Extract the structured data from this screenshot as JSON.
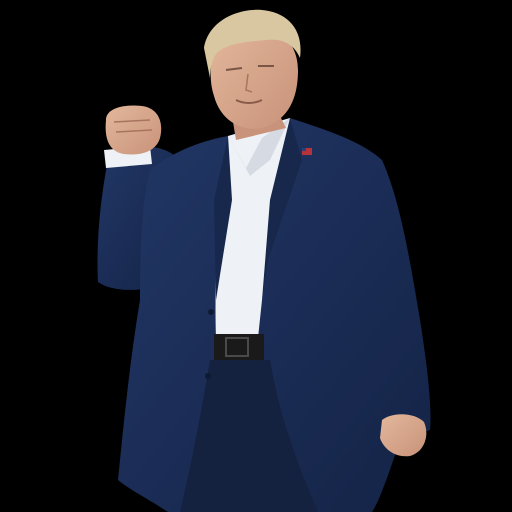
{
  "scene": {
    "background_color": "#000000",
    "suit_color": "#1c2f57",
    "suit_shadow_color": "#12203d",
    "shirt_color": "#eef1f5",
    "skin_color": "#d9a98c",
    "hair_color": "#d8c7a0",
    "belt_color": "#1a1a1a",
    "pin_color": "#b8323a"
  }
}
